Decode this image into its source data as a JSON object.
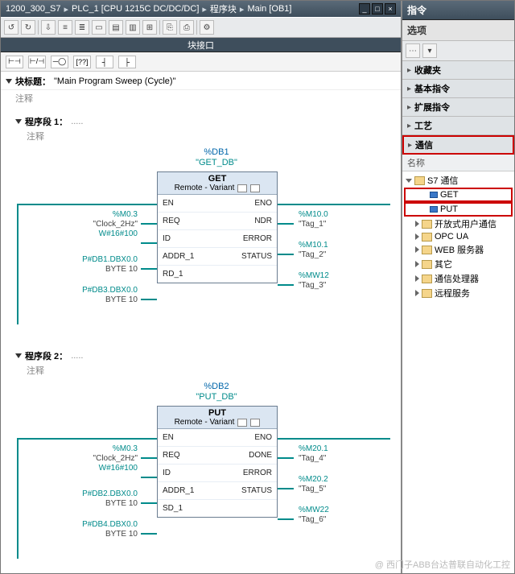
{
  "breadcrumb": [
    "1200_300_S7",
    "PLC_1 [CPU 1215C DC/DC/DC]",
    "程序块",
    "Main [OB1]"
  ],
  "tab_strip": "块接口",
  "block_header": {
    "label": "块标题：",
    "value": "\"Main Program Sweep (Cycle)\"",
    "comment": "注释"
  },
  "networks": [
    {
      "title": "程序段 1：",
      "comment": "注释",
      "db": {
        "id": "%DB1",
        "name": "\"GET_DB\""
      },
      "fb": {
        "name": "GET",
        "subtitle": "Remote  -  Variant",
        "left_ports": [
          "EN",
          "REQ",
          "ID",
          "ADDR_1",
          "RD_1"
        ],
        "right_ports": [
          "ENO",
          "NDR",
          "ERROR",
          "STATUS"
        ]
      },
      "left_params": [
        {
          "addr": "%M0.3",
          "tag": "\"Clock_2Hz\""
        },
        {
          "addr": "W#16#100"
        },
        {
          "addr": "P#DB1.DBX0.0",
          "tag": "BYTE 10"
        },
        {
          "addr": "P#DB3.DBX0.0",
          "tag": "BYTE 10"
        }
      ],
      "right_params": [
        {
          "addr": "%M10.0",
          "tag": "\"Tag_1\""
        },
        {
          "addr": "%M10.1",
          "tag": "\"Tag_2\""
        },
        {
          "addr": "%MW12",
          "tag": "\"Tag_3\""
        }
      ]
    },
    {
      "title": "程序段 2：",
      "comment": "注释",
      "db": {
        "id": "%DB2",
        "name": "\"PUT_DB\""
      },
      "fb": {
        "name": "PUT",
        "subtitle": "Remote  -  Variant",
        "left_ports": [
          "EN",
          "REQ",
          "ID",
          "ADDR_1",
          "SD_1"
        ],
        "right_ports": [
          "ENO",
          "DONE",
          "ERROR",
          "STATUS"
        ]
      },
      "left_params": [
        {
          "addr": "%M0.3",
          "tag": "\"Clock_2Hz\""
        },
        {
          "addr": "W#16#100"
        },
        {
          "addr": "P#DB2.DBX0.0",
          "tag": "BYTE 10"
        },
        {
          "addr": "P#DB4.DBX0.0",
          "tag": "BYTE 10"
        }
      ],
      "right_params": [
        {
          "addr": "%M20.1",
          "tag": "\"Tag_4\""
        },
        {
          "addr": "%M20.2",
          "tag": "\"Tag_5\""
        },
        {
          "addr": "%MW22",
          "tag": "\"Tag_6\""
        }
      ]
    }
  ],
  "side": {
    "title": "指令",
    "options": "选项",
    "groups": [
      "收藏夹",
      "基本指令",
      "扩展指令",
      "工艺",
      "通信"
    ],
    "col_header": "名称",
    "tree": {
      "root": "S7 通信",
      "children": [
        "GET",
        "PUT"
      ],
      "siblings": [
        "开放式用户通信",
        "OPC UA",
        "WEB 服务器",
        "其它",
        "通信处理器",
        "远程服务"
      ]
    }
  },
  "watermark": "@ 西门子ABB台达普联自动化工控"
}
